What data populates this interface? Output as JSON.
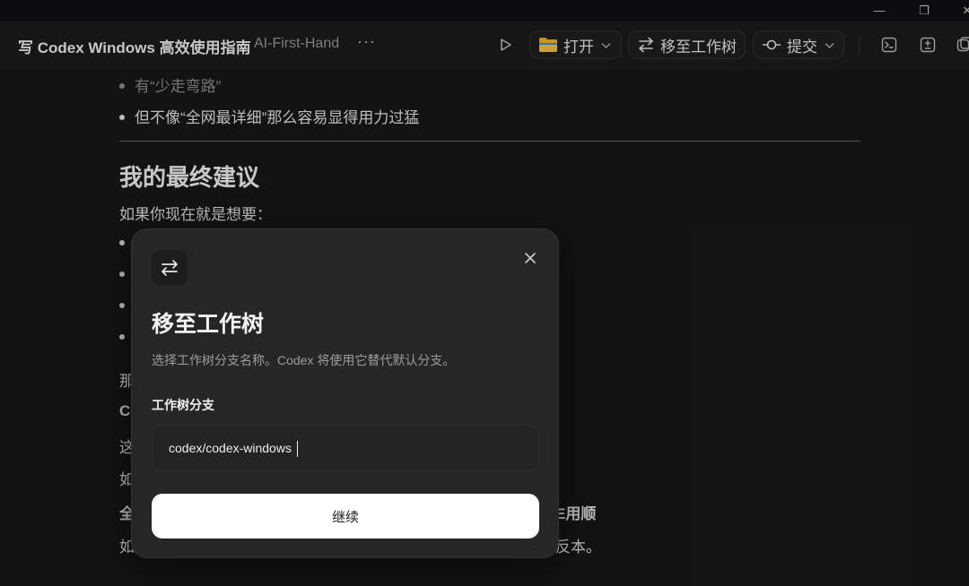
{
  "window": {
    "controls": [
      "—",
      "❐",
      "✕"
    ]
  },
  "toolbar": {
    "title": "写 Codex Windows 高效使用指南",
    "subtitle": "AI-First-Hand",
    "more": "···",
    "open_label": "打开",
    "move_label": "移至工作树",
    "commit_label": "提交",
    "icons": [
      "terminal-icon",
      "diff-icon",
      "split-view-icon"
    ]
  },
  "document": {
    "bullets_top": [
      "有“少走弯路”",
      "但不像“全网最详细”那么容易显得用力过猛"
    ],
    "heading": "我的最终建议",
    "intro": "如果你现在就是想要：",
    "fragments": {
      "line1": "那",
      "line2": "Co",
      "line3": "这",
      "line4": "如",
      "line5_start": "全",
      "line5_end": "E用顺",
      "line6_start": "如",
      "line6_end": "反本。"
    }
  },
  "modal": {
    "title": "移至工作树",
    "description": "选择工作树分支名称。Codex 将使用它替代默认分支。",
    "field_label": "工作树分支",
    "branch_value": "codex/codex-windows",
    "continue_label": "继续"
  },
  "colors": {
    "background": "#181818",
    "modal_bg": "#262626",
    "button_bg": "#ffffff",
    "folder_yellow": "#f2b632"
  }
}
